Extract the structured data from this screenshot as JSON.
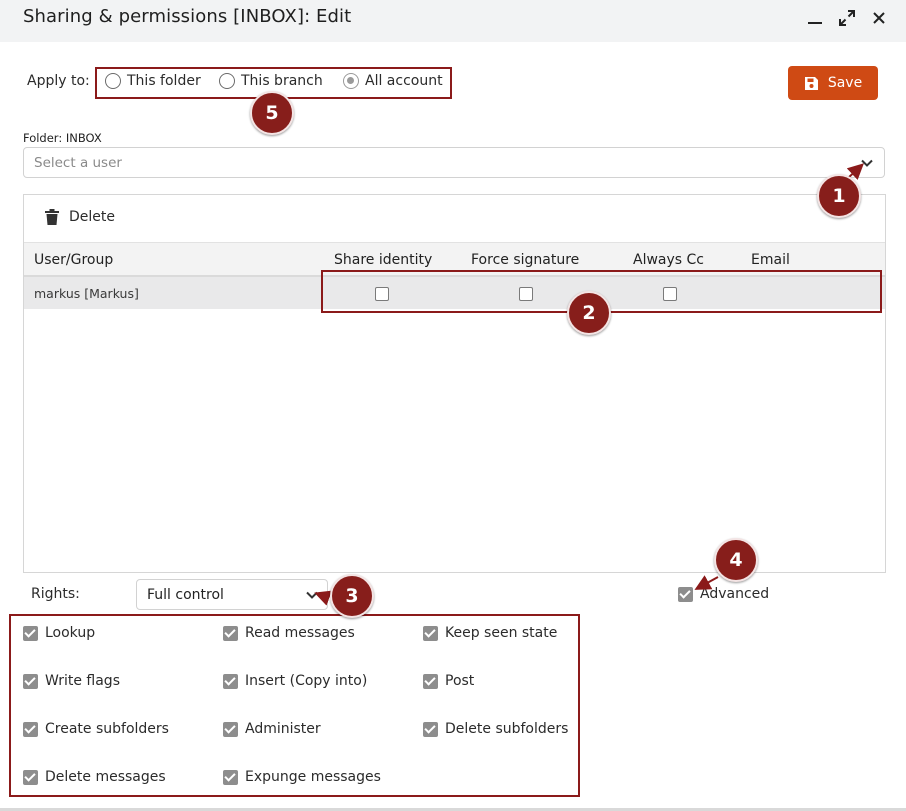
{
  "window": {
    "title": "Sharing & permissions [INBOX]: Edit",
    "controls": [
      "minimize-icon",
      "expand-icon",
      "close-icon"
    ]
  },
  "apply": {
    "label": "Apply to:",
    "options": [
      {
        "label": "This folder",
        "selected": false
      },
      {
        "label": "This branch",
        "selected": false
      },
      {
        "label": "All account",
        "selected": true
      }
    ]
  },
  "save": {
    "label": "Save",
    "icon": "floppy-disk-icon",
    "color": "#cf4a14"
  },
  "folder": {
    "label": "Folder: INBOX",
    "user_select_placeholder": "Select a user"
  },
  "toolbar": {
    "delete_label": "Delete",
    "delete_icon": "trash-icon"
  },
  "table": {
    "headers": [
      "User/Group",
      "Share identity",
      "Force signature",
      "Always Cc",
      "Email"
    ],
    "rows": [
      {
        "user": "markus [Markus]",
        "share_identity": false,
        "force_signature": false,
        "always_cc": false,
        "email": ""
      }
    ]
  },
  "rights": {
    "label": "Rights:",
    "selected": "Full control",
    "advanced_label": "Advanced",
    "advanced_checked": true,
    "permissions": [
      {
        "label": "Lookup",
        "checked": true
      },
      {
        "label": "Read messages",
        "checked": true
      },
      {
        "label": "Keep seen state",
        "checked": true
      },
      {
        "label": "Write flags",
        "checked": true
      },
      {
        "label": "Insert (Copy into)",
        "checked": true
      },
      {
        "label": "Post",
        "checked": true
      },
      {
        "label": "Create subfolders",
        "checked": true
      },
      {
        "label": "Administer",
        "checked": true
      },
      {
        "label": "Delete subfolders",
        "checked": true
      },
      {
        "label": "Delete messages",
        "checked": true
      },
      {
        "label": "Expunge messages",
        "checked": true
      }
    ]
  },
  "annotations": {
    "badges": [
      "1",
      "2",
      "3",
      "4",
      "5"
    ],
    "color": "#8b1a1a"
  }
}
